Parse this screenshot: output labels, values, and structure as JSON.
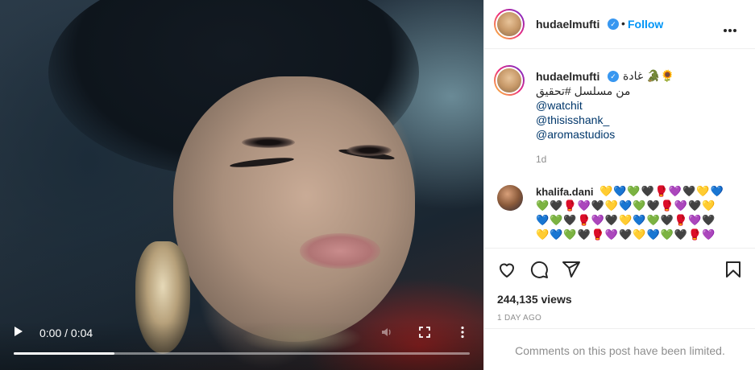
{
  "video": {
    "time_display": "0:00 / 0:04",
    "progress": 0.22
  },
  "post": {
    "author": {
      "username": "hudaelmufti",
      "verified": true
    },
    "header": {
      "separator": "•",
      "follow_label": "Follow"
    },
    "caption": {
      "line1": "غادة 🐊🌻",
      "line2": "من مسلسل #تحقيق",
      "mentions": [
        "@watchit",
        "@thisisshank_",
        "@aromastudios"
      ],
      "timestamp": "1d"
    },
    "comment": {
      "username": "khalifa.dani",
      "rows": [
        "💛💙💚🖤🥊💜🖤💛💙",
        "💚🖤🥊💜🖤💛💙💚🖤🥊💜🖤💛",
        "💙💚🖤🥊💜🖤💛💙💚🖤🥊💜🖤",
        "💛💙💚🖤🥊💜🖤💛💙💚🖤🥊💜"
      ]
    },
    "stats": {
      "views": "244,135 views",
      "time_ago": "1 DAY AGO"
    },
    "comments_limited": "Comments on this post have been limited."
  },
  "icons": {
    "play": "play-icon",
    "volume": "volume-icon",
    "fullscreen": "fullscreen-icon",
    "more_vertical": "more-vertical-icon",
    "more_horizontal": "more-horizontal-icon",
    "like": "heart-icon",
    "comment": "comment-icon",
    "share": "share-icon",
    "save": "bookmark-icon",
    "verified": "verified-badge-icon"
  },
  "colors": {
    "follow": "#0095f6",
    "verified": "#3897f0",
    "mention": "#00376b",
    "secondary_text": "#8e8e8e"
  }
}
